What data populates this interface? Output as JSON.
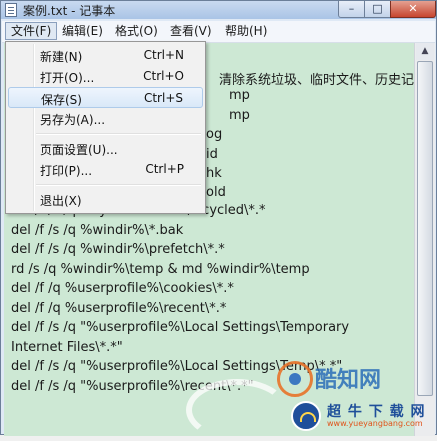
{
  "window": {
    "title": "案例.txt - 记事本",
    "minimize_glyph": "–",
    "maximize_glyph": "□",
    "close_glyph": "✕"
  },
  "menubar": {
    "items": [
      {
        "label": "文件(F)",
        "active": true
      },
      {
        "label": "编辑(E)",
        "active": false
      },
      {
        "label": "格式(O)",
        "active": false
      },
      {
        "label": "查看(V)",
        "active": false
      },
      {
        "label": "帮助(H)",
        "active": false
      }
    ]
  },
  "file_menu": {
    "items": [
      {
        "label": "新建(N)",
        "shortcut": "Ctrl+N"
      },
      {
        "label": "打开(O)...",
        "shortcut": "Ctrl+O"
      },
      {
        "label": "保存(S)",
        "shortcut": "Ctrl+S",
        "highlighted": true
      },
      {
        "label": "另存为(A)...",
        "shortcut": ""
      },
      {
        "label": "页面设置(U)...",
        "shortcut": ""
      },
      {
        "label": "打印(P)...",
        "shortcut": "Ctrl+P"
      },
      {
        "label": "退出(X)",
        "shortcut": ""
      }
    ]
  },
  "editor": {
    "background_color": "#cde8d4",
    "visible_fragments": [
      "清除系统垃圾、临时文件、历史记录等......",
      "mp",
      "mp",
      "og",
      "id",
      "hk",
      "old"
    ],
    "lines": [
      "del /f /s /q %systemdrive%\\recycled\\*.*",
      "del /f /s /q %windir%\\*.bak",
      "del /f /s /q %windir%\\prefetch\\*.*",
      "rd /s /q %windir%\\temp & md %windir%\\temp",
      "del /f /q %userprofile%\\cookies\\*.*",
      "del /f /q %userprofile%\\recent\\*.*",
      "del /f /s /q \"%userprofile%\\Local Settings\\Temporary",
      "Internet Files\\*.*\"",
      "del /f /s /q \"%userprofile%\\Local Settings\\Temp\\*.*\"",
      "del /f /s /q \"%userprofile%\\recent\\*.*\""
    ]
  },
  "watermark": {
    "brand": "酷知网",
    "site_name": "超 牛 下 载 网",
    "site_url": "www.yueyangbang.com",
    "accent_color": "#2c6fb8",
    "icon": "coolzhi-logo-icon"
  }
}
